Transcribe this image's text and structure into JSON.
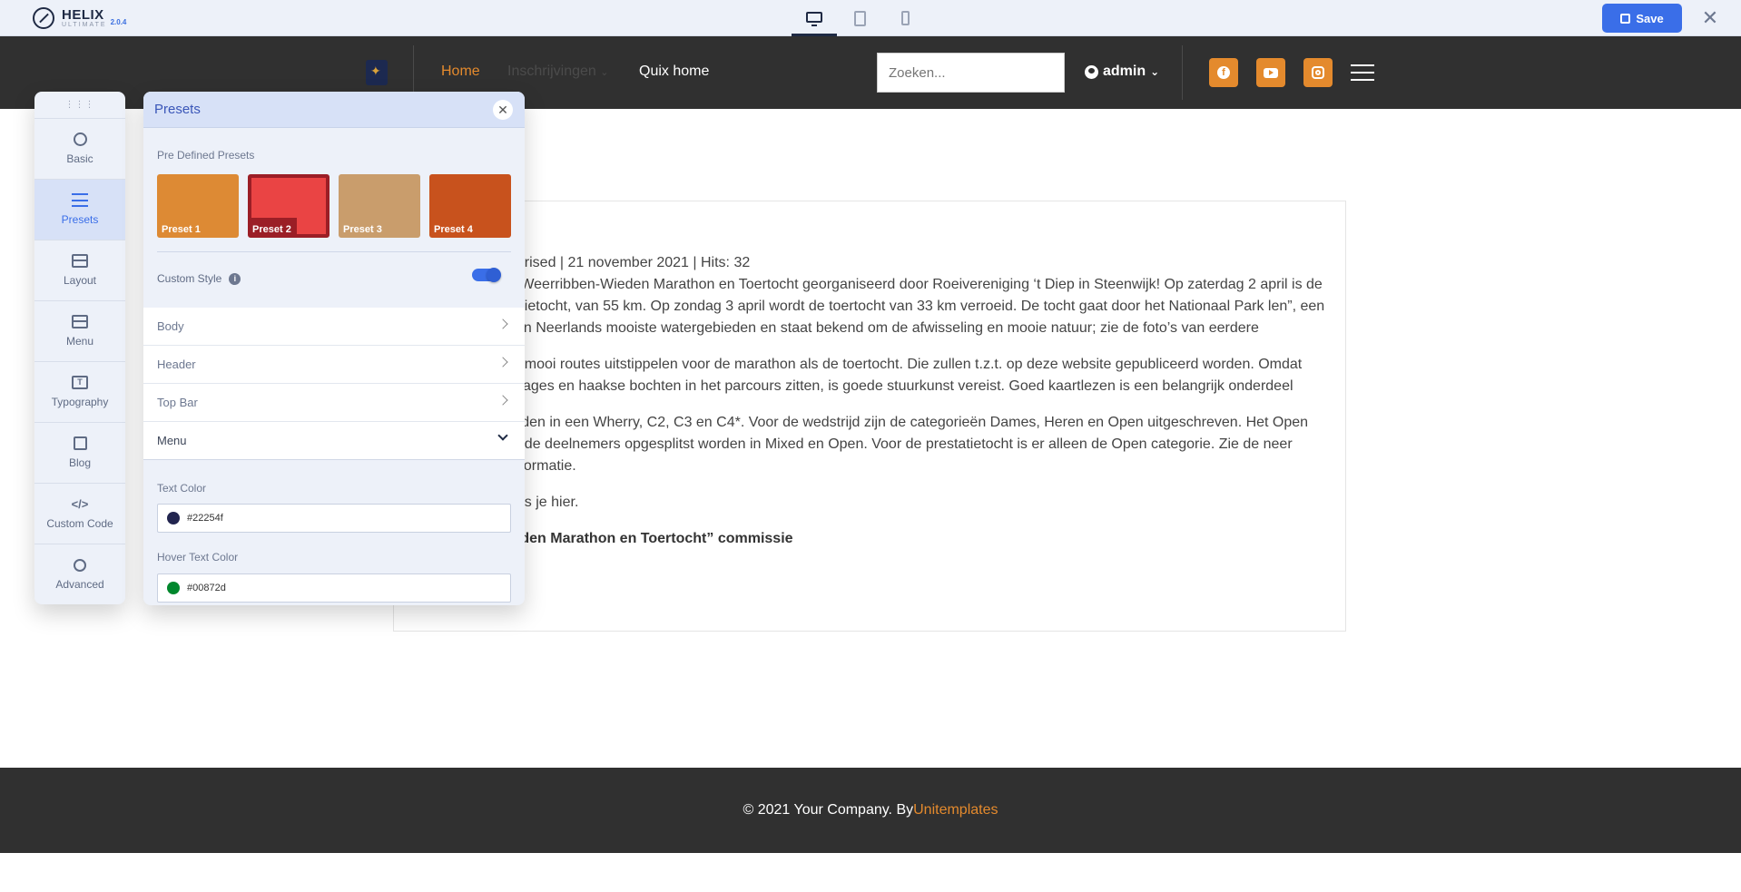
{
  "helix": {
    "name": "HELIX",
    "subtitle": "ULTIMATE",
    "version": "2.0.4",
    "save_label": "Save"
  },
  "site_nav": {
    "items": [
      {
        "label": "Home",
        "color": "#e48a2d"
      },
      {
        "label": "Inschrijvingen"
      },
      {
        "label": "Quix home"
      }
    ],
    "search_placeholder": "Zoeken...",
    "user": "admin"
  },
  "article": {
    "meta": "gorised  |   21 november 2021   |   Hits: 32",
    "p1": "e Weerribben-Wieden Marathon en Toertocht georganiseerd door Roeivereniging ‘t Diep in Steenwijk! Op zaterdag 2 april is de tatietocht, van 55 km. Op zondag 3 april wordt de toertocht van 33 km verroeid. De tocht gaat door het Nationaal Park len”, een van Neerlands mooiste watergebieden en staat bekend om de afwisseling en mooie natuur; zie de foto’s van eerdere",
    "p2": "m mooi routes uitstippelen voor de marathon als de toertocht. Die zullen t.z.t. op deze website gepubliceerd worden. Omdat ssages en haakse bochten in het parcours zitten, is goede stuurkunst vereist. Goed kaartlezen is een belangrijk onderdeel",
    "p3": "orden in een Wherry, C2, C3 en C4*. Voor de wedstrijd zijn de categorieën Dames, Heren en Open uitgeschreven. Het Open ende deelnemers opgesplitst worden in Mixed en Open. Voor de prestatietocht is er alleen de Open categorie. Zie de neer informatie.",
    "p4": "ees je hier.",
    "p5": "ieden Marathon en Toertocht” commissie"
  },
  "footer": {
    "text": "© 2021 Your Company. By ",
    "link": "Unitemplates",
    "link_color": "#e48a2d"
  },
  "sidebar": {
    "items": [
      {
        "label": "Basic",
        "icon": "gear-icon"
      },
      {
        "label": "Presets",
        "icon": "sliders-icon",
        "active": true
      },
      {
        "label": "Layout",
        "icon": "layout-icon"
      },
      {
        "label": "Menu",
        "icon": "menu-icon"
      },
      {
        "label": "Typography",
        "icon": "typography-icon"
      },
      {
        "label": "Blog",
        "icon": "blog-icon"
      },
      {
        "label": "Custom Code",
        "icon": "code-icon"
      },
      {
        "label": "Advanced",
        "icon": "advanced-icon"
      }
    ]
  },
  "panel": {
    "title": "Presets",
    "predefined_label": "Pre Defined Presets",
    "presets": [
      {
        "label": "Preset 1",
        "color": "#dd8a34"
      },
      {
        "label": "Preset 2",
        "color": "#ea4444",
        "selected": true
      },
      {
        "label": "Preset 3",
        "color": "#c99d6c"
      },
      {
        "label": "Preset 4",
        "color": "#c8521d"
      }
    ],
    "custom_style_label": "Custom Style",
    "custom_style_on": true,
    "accordion": [
      {
        "label": "Body"
      },
      {
        "label": "Header"
      },
      {
        "label": "Top Bar"
      },
      {
        "label": "Menu",
        "open": true
      }
    ],
    "text_color_label": "Text Color",
    "text_color_value": "#22254f",
    "hover_color_label": "Hover Text Color",
    "hover_color_value": "#00872d"
  }
}
